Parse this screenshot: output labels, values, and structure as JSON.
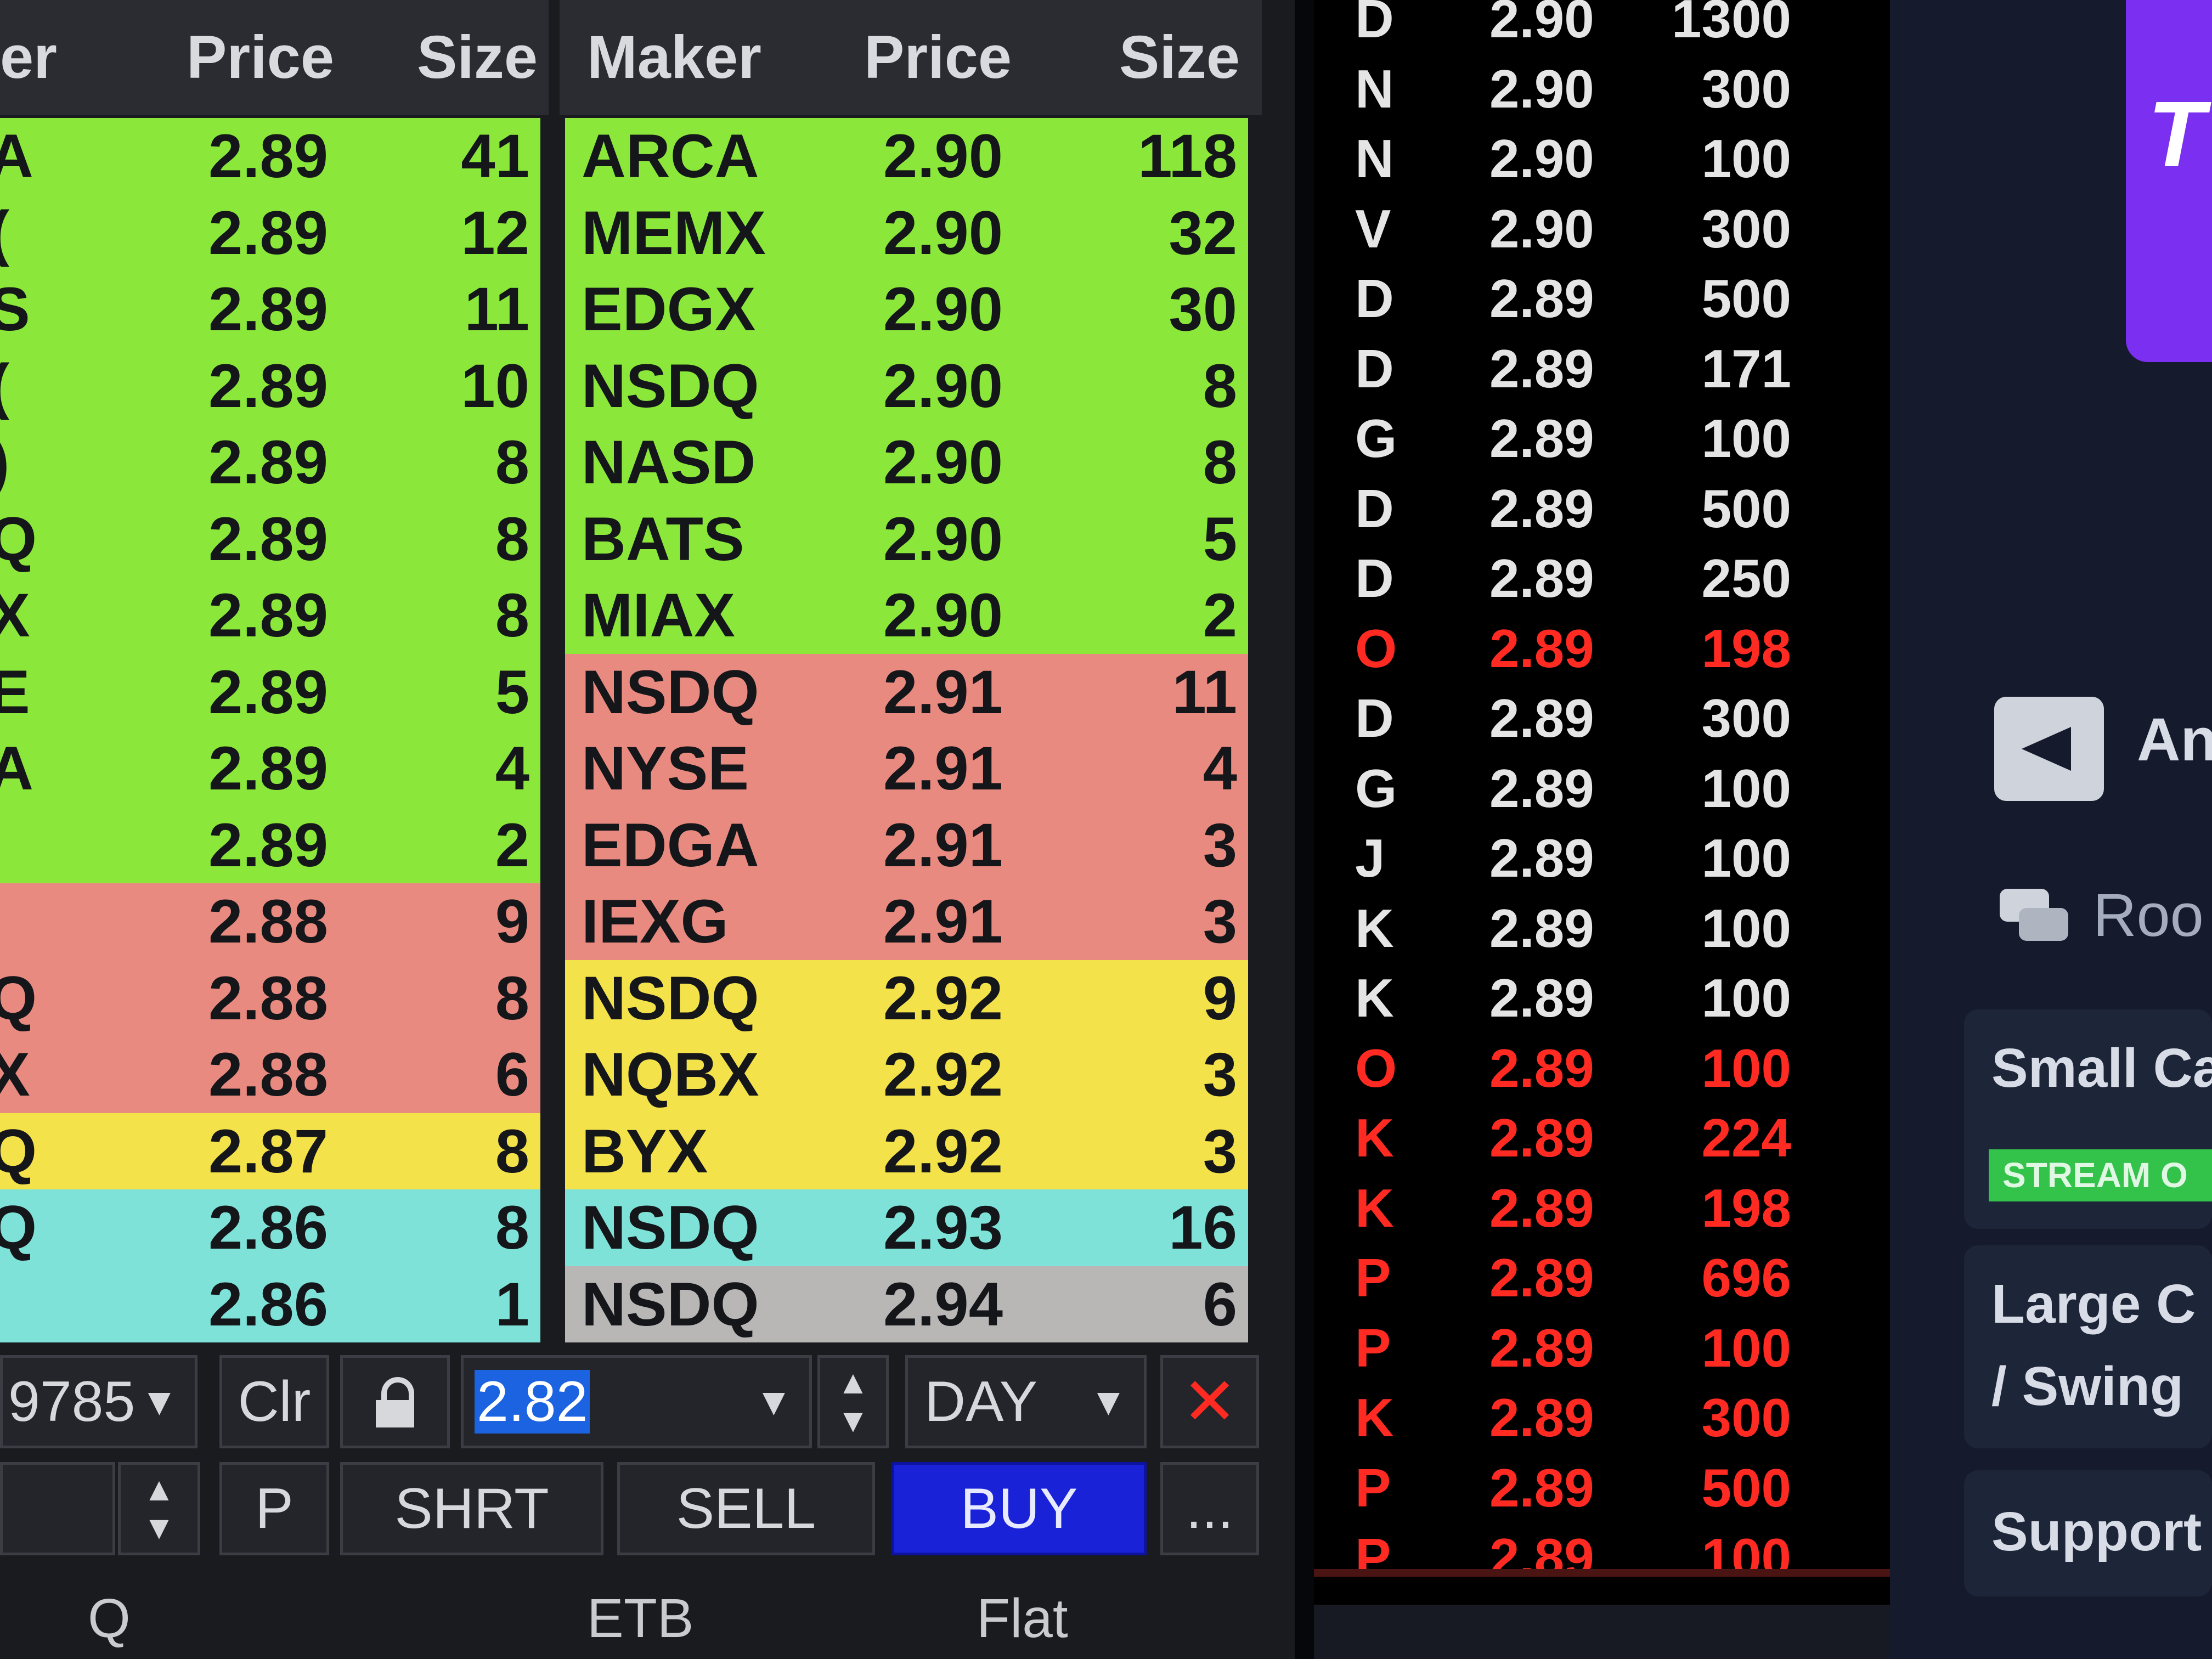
{
  "bid_headers": {
    "maker": "er",
    "price": "Price",
    "size": "Size"
  },
  "ask_headers": {
    "maker": "Maker",
    "price": "Price",
    "size": "Size"
  },
  "bids": [
    {
      "maker": "A",
      "price": "2.89",
      "size": "41",
      "band": "g"
    },
    {
      "maker": "(",
      "price": "2.89",
      "size": "12",
      "band": "g"
    },
    {
      "maker": "S",
      "price": "2.89",
      "size": "11",
      "band": "g"
    },
    {
      "maker": "(",
      "price": "2.89",
      "size": "10",
      "band": "g"
    },
    {
      "maker": ")",
      "price": "2.89",
      "size": "8",
      "band": "g"
    },
    {
      "maker": "Q",
      "price": "2.89",
      "size": "8",
      "band": "g"
    },
    {
      "maker": "X",
      "price": "2.89",
      "size": "8",
      "band": "g"
    },
    {
      "maker": "E",
      "price": "2.89",
      "size": "5",
      "band": "g"
    },
    {
      "maker": "A",
      "price": "2.89",
      "size": "4",
      "band": "g"
    },
    {
      "maker": "",
      "price": "2.89",
      "size": "2",
      "band": "g"
    },
    {
      "maker": "",
      "price": "2.88",
      "size": "9",
      "band": "r"
    },
    {
      "maker": "Q",
      "price": "2.88",
      "size": "8",
      "band": "r"
    },
    {
      "maker": "X",
      "price": "2.88",
      "size": "6",
      "band": "r"
    },
    {
      "maker": "Q",
      "price": "2.87",
      "size": "8",
      "band": "y"
    },
    {
      "maker": "Q",
      "price": "2.86",
      "size": "8",
      "band": "c"
    },
    {
      "maker": "",
      "price": "2.86",
      "size": "1",
      "band": "c"
    }
  ],
  "asks": [
    {
      "maker": "ARCA",
      "price": "2.90",
      "size": "118",
      "band": "g"
    },
    {
      "maker": "MEMX",
      "price": "2.90",
      "size": "32",
      "band": "g"
    },
    {
      "maker": "EDGX",
      "price": "2.90",
      "size": "30",
      "band": "g"
    },
    {
      "maker": "NSDQ",
      "price": "2.90",
      "size": "8",
      "band": "g"
    },
    {
      "maker": "NASD",
      "price": "2.90",
      "size": "8",
      "band": "g"
    },
    {
      "maker": "BATS",
      "price": "2.90",
      "size": "5",
      "band": "g"
    },
    {
      "maker": "MIAX",
      "price": "2.90",
      "size": "2",
      "band": "g"
    },
    {
      "maker": "NSDQ",
      "price": "2.91",
      "size": "11",
      "band": "r"
    },
    {
      "maker": "NYSE",
      "price": "2.91",
      "size": "4",
      "band": "r"
    },
    {
      "maker": "EDGA",
      "price": "2.91",
      "size": "3",
      "band": "r"
    },
    {
      "maker": "IEXG",
      "price": "2.91",
      "size": "3",
      "band": "r"
    },
    {
      "maker": "NSDQ",
      "price": "2.92",
      "size": "9",
      "band": "y"
    },
    {
      "maker": "NQBX",
      "price": "2.92",
      "size": "3",
      "band": "y"
    },
    {
      "maker": "BYX",
      "price": "2.92",
      "size": "3",
      "band": "y"
    },
    {
      "maker": "NSDQ",
      "price": "2.93",
      "size": "16",
      "band": "c"
    },
    {
      "maker": "NSDQ",
      "price": "2.94",
      "size": "6",
      "band": "gr"
    }
  ],
  "order_entry": {
    "account": "9785",
    "clr": "Clr",
    "price": "2.82",
    "tif": "DAY",
    "p": "P",
    "shrt": "SHRT",
    "sell": "SELL",
    "buy": "BUY",
    "more": "...",
    "status_q": "Q",
    "status_etb": "ETB",
    "status_flat": "Flat"
  },
  "trades": [
    {
      "ex": "D",
      "price": "2.90",
      "size": "1300",
      "red": false
    },
    {
      "ex": "N",
      "price": "2.90",
      "size": "300",
      "red": false
    },
    {
      "ex": "N",
      "price": "2.90",
      "size": "100",
      "red": false
    },
    {
      "ex": "V",
      "price": "2.90",
      "size": "300",
      "red": false
    },
    {
      "ex": "D",
      "price": "2.89",
      "size": "500",
      "red": false
    },
    {
      "ex": "D",
      "price": "2.89",
      "size": "171",
      "red": false
    },
    {
      "ex": "G",
      "price": "2.89",
      "size": "100",
      "red": false
    },
    {
      "ex": "D",
      "price": "2.89",
      "size": "500",
      "red": false
    },
    {
      "ex": "D",
      "price": "2.89",
      "size": "250",
      "red": false
    },
    {
      "ex": "O",
      "price": "2.89",
      "size": "198",
      "red": true
    },
    {
      "ex": "D",
      "price": "2.89",
      "size": "300",
      "red": false
    },
    {
      "ex": "G",
      "price": "2.89",
      "size": "100",
      "red": false
    },
    {
      "ex": "J",
      "price": "2.89",
      "size": "100",
      "red": false
    },
    {
      "ex": "K",
      "price": "2.89",
      "size": "100",
      "red": false
    },
    {
      "ex": "K",
      "price": "2.89",
      "size": "100",
      "red": false
    },
    {
      "ex": "O",
      "price": "2.89",
      "size": "100",
      "red": true
    },
    {
      "ex": "K",
      "price": "2.89",
      "size": "224",
      "red": true
    },
    {
      "ex": "K",
      "price": "2.89",
      "size": "198",
      "red": true
    },
    {
      "ex": "P",
      "price": "2.89",
      "size": "696",
      "red": true
    },
    {
      "ex": "P",
      "price": "2.89",
      "size": "100",
      "red": true
    },
    {
      "ex": "K",
      "price": "2.89",
      "size": "300",
      "red": true
    },
    {
      "ex": "P",
      "price": "2.89",
      "size": "500",
      "red": true
    },
    {
      "ex": "P",
      "price": "2.89",
      "size": "100",
      "red": true
    }
  ],
  "sidebar": {
    "logo_text": "T D",
    "announce": "An",
    "rooms": "Roo",
    "small_cap": "Small Ca",
    "stream": "STREAM O",
    "large_cap_1": "Large C",
    "large_cap_2": "/ Swing",
    "support": "Support"
  },
  "colors": {
    "bid_green": "#8be83a",
    "level_red": "#e98a80",
    "level_yellow": "#f3e24a",
    "level_cyan": "#7fe2d8",
    "trade_red": "#ff2b23",
    "buy_blue": "#1a22d8",
    "brand_purple": "#7b2ff0"
  }
}
